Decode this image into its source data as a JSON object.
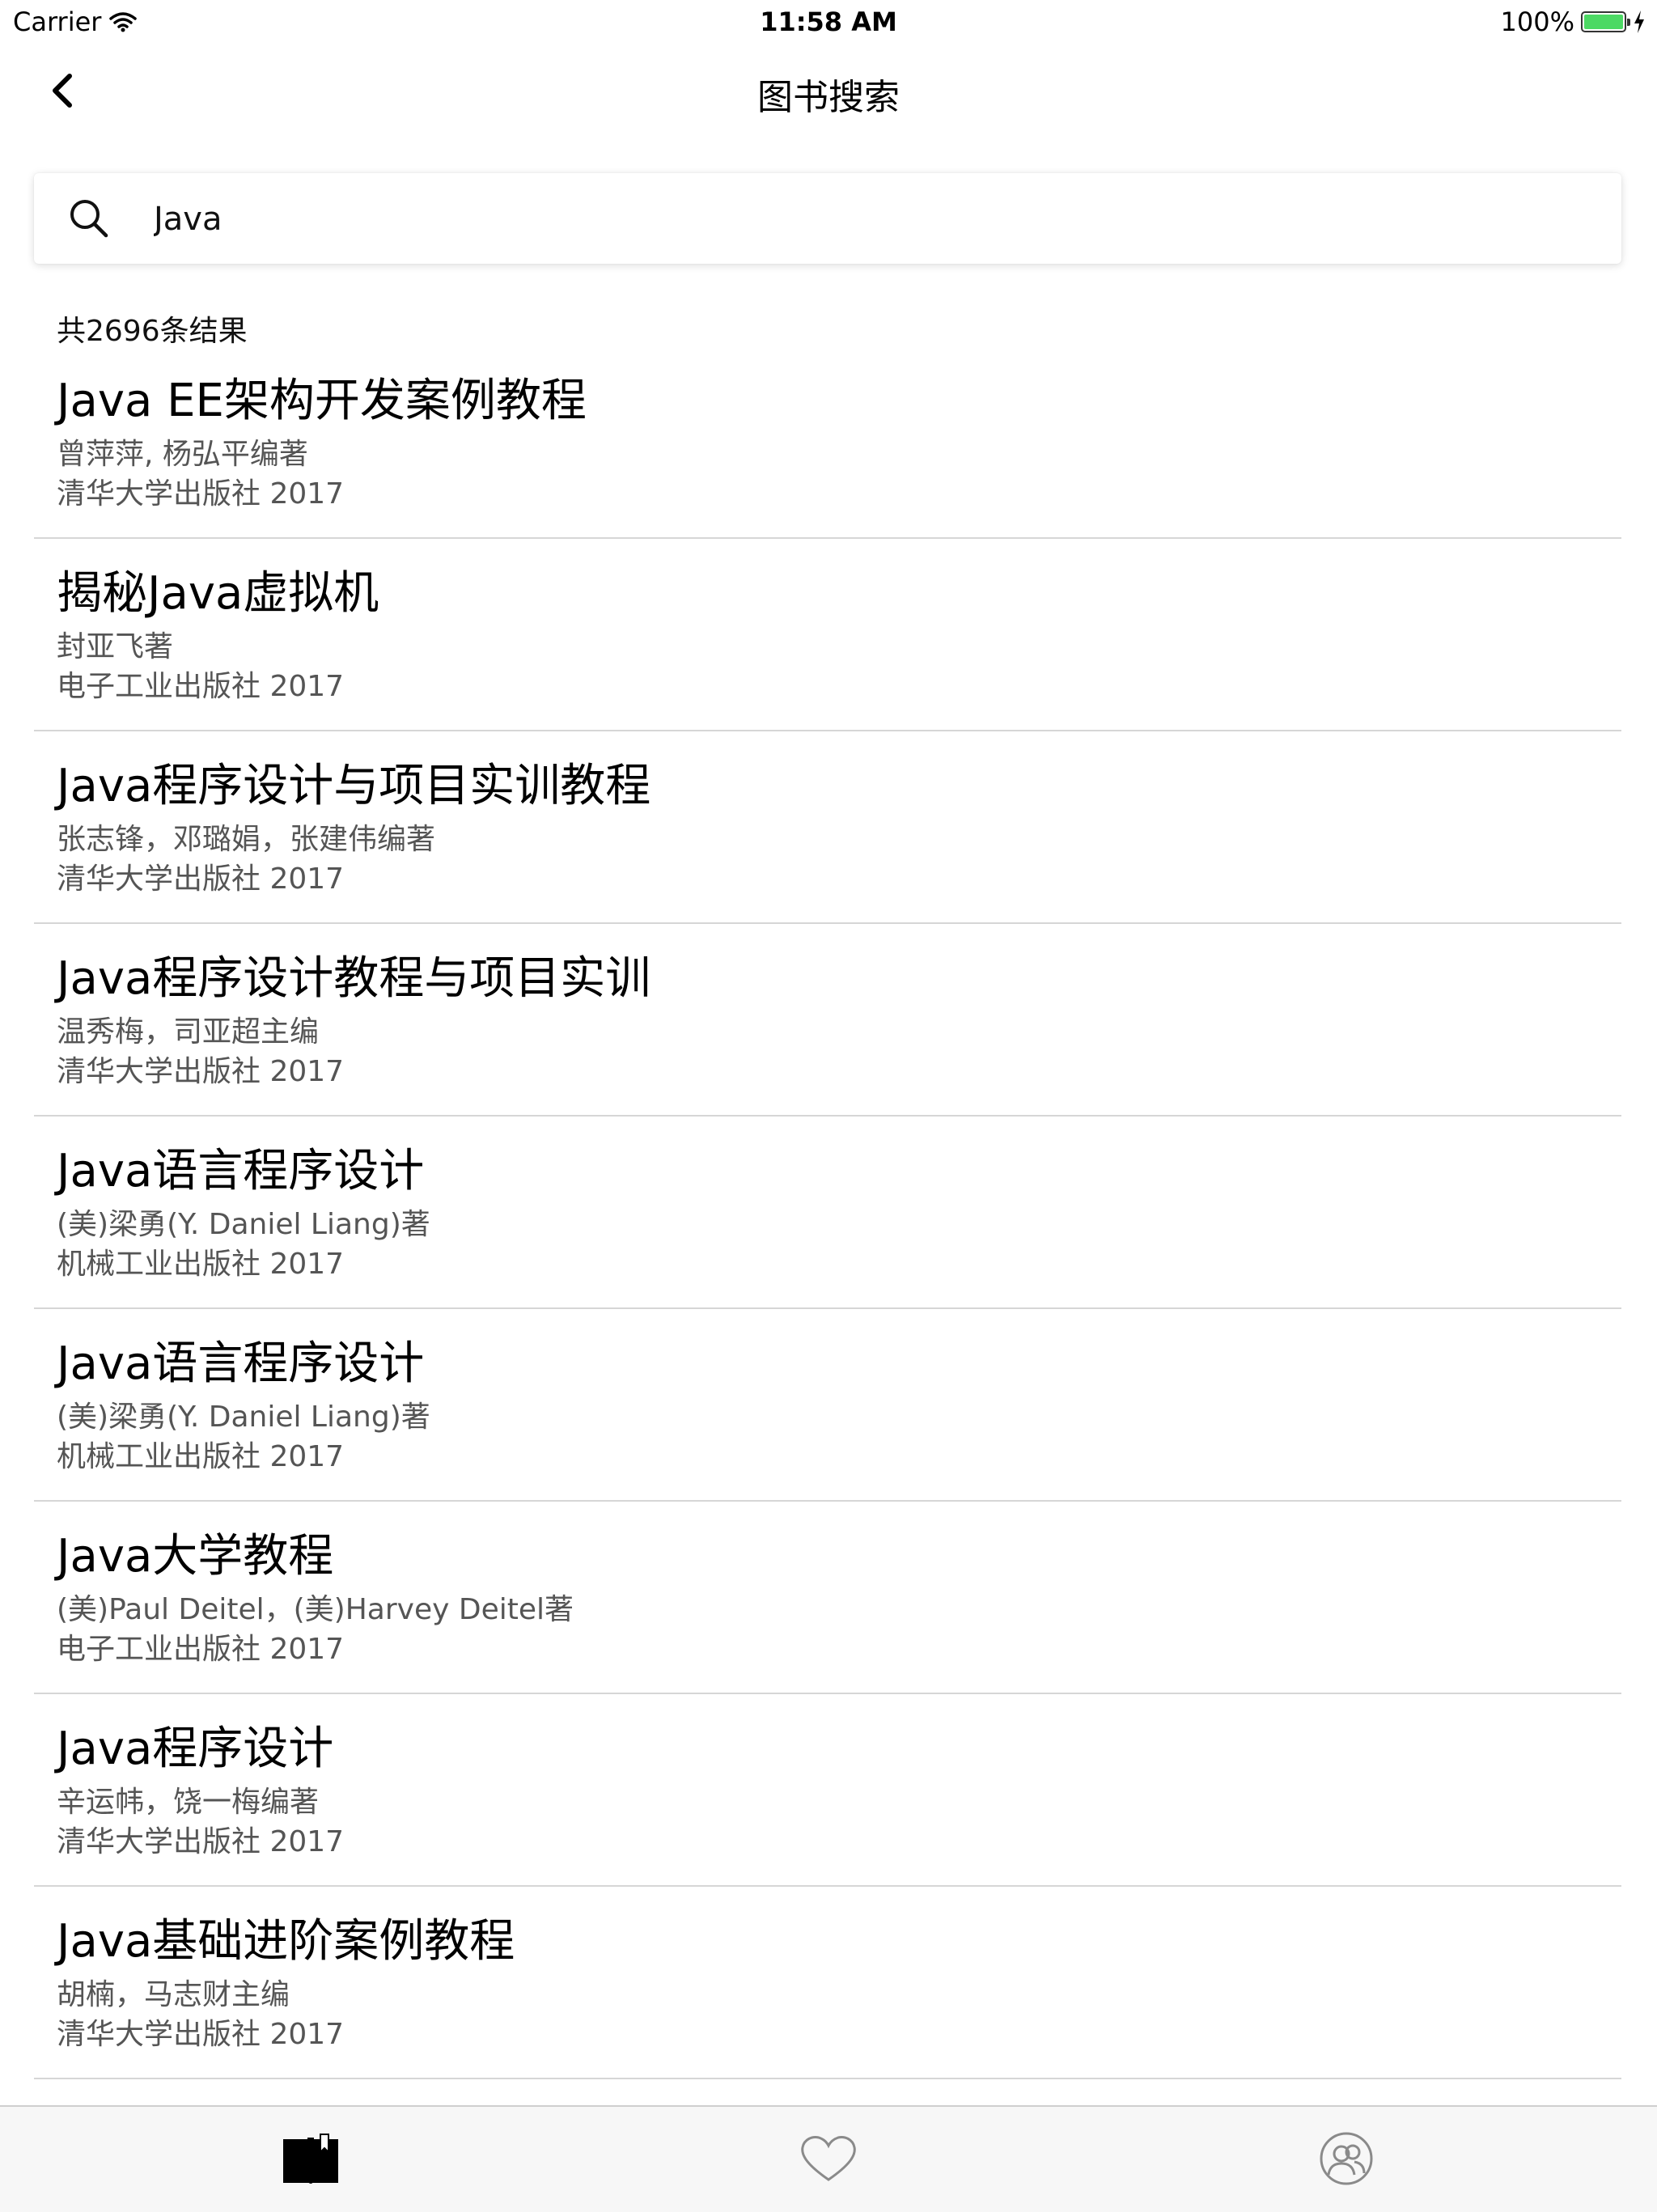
{
  "status_bar": {
    "carrier": "Carrier",
    "time": "11:58 AM",
    "battery": "100%",
    "battery_level": 1.0
  },
  "nav": {
    "title": "图书搜索",
    "back_icon": "chevron-left-icon"
  },
  "search": {
    "value": "Java",
    "icon": "search-icon"
  },
  "result_count": "共2696条结果",
  "results": [
    {
      "title": "Java EE架构开发案例教程",
      "author": "曾萍萍, 杨弘平编著",
      "publisher": "清华大学出版社 2017"
    },
    {
      "title": "揭秘Java虚拟机",
      "author": "封亚飞著",
      "publisher": "电子工业出版社 2017"
    },
    {
      "title": "Java程序设计与项目实训教程",
      "author": "张志锋，邓璐娟，张建伟编著",
      "publisher": "清华大学出版社 2017"
    },
    {
      "title": "Java程序设计教程与项目实训",
      "author": "温秀梅，司亚超主编",
      "publisher": "清华大学出版社 2017"
    },
    {
      "title": "Java语言程序设计",
      "author": "(美)梁勇(Y. Daniel Liang)著",
      "publisher": "机械工业出版社 2017"
    },
    {
      "title": "Java语言程序设计",
      "author": "(美)梁勇(Y. Daniel Liang)著",
      "publisher": "机械工业出版社 2017"
    },
    {
      "title": "Java大学教程",
      "author": "(美)Paul Deitel，(美)Harvey Deitel著",
      "publisher": "电子工业出版社 2017"
    },
    {
      "title": "Java程序设计",
      "author": "辛运帏，饶一梅编著",
      "publisher": "清华大学出版社 2017"
    },
    {
      "title": "Java基础进阶案例教程",
      "author": "胡楠，马志财主编",
      "publisher": "清华大学出版社 2017"
    }
  ],
  "tabbar": {
    "tabs": [
      {
        "icon": "book-icon",
        "selected": true
      },
      {
        "icon": "heart-icon",
        "selected": false
      },
      {
        "icon": "profile-icon",
        "selected": false
      }
    ]
  }
}
